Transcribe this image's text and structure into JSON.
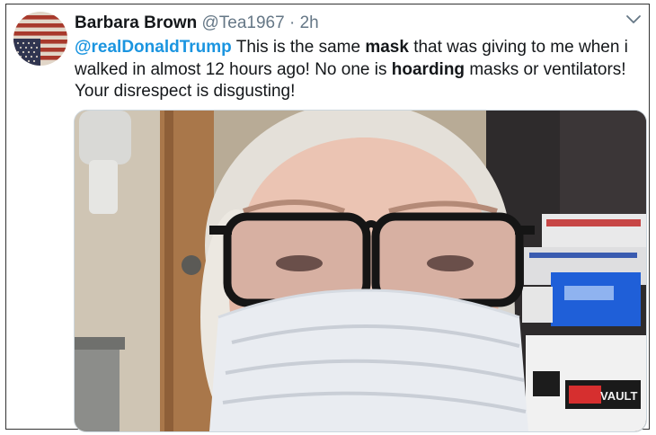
{
  "tweet": {
    "author_name": "Barbara Brown",
    "handle": "@Tea1967",
    "separator": "·",
    "time": "2h",
    "mention": "@realDonaldTrump",
    "text_1": " This is the same ",
    "bold_1": "mask",
    "text_2": " that was giving to me when i walked in almost 12 hours ago! No one is ",
    "bold_2": "hoarding",
    "text_3": " masks or ventilators! Your disrespect is disgusting!",
    "mention_color": "#1b95e0"
  },
  "photo": {
    "bin_label": "VAULT"
  },
  "icons": {
    "avatar": "upside-down-us-flag-avatar",
    "menu": "chevron-down-icon"
  }
}
